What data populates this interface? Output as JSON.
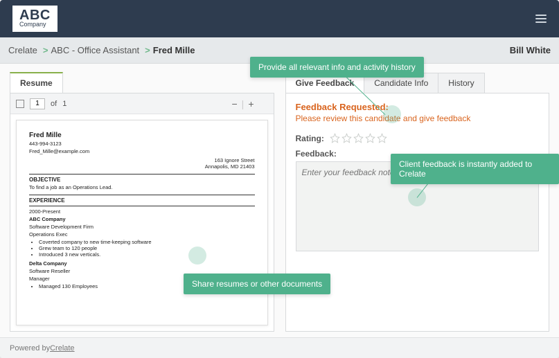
{
  "logo": {
    "big": "ABC",
    "small": "Company"
  },
  "breadcrumb": {
    "root": "Crelate",
    "level1": "ABC - Office Assistant",
    "current": "Fred Mille",
    "sep": ">"
  },
  "user_name": "Bill White",
  "left_panel": {
    "tabs": {
      "resume": "Resume"
    },
    "pdf": {
      "page_current": "1",
      "page_sep": "of",
      "page_total": "1",
      "zoom_out": "−",
      "zoom_in": "+"
    },
    "resume": {
      "name": "Fred Mille",
      "phone": "443-994-3123",
      "email": "Fred_Mille@example.com",
      "addr1": "163 Ignore Street",
      "addr2": "Annapolis, MD 21403",
      "sec1_title": "OBJECTIVE",
      "sec1_body": "To find a job as an Operations Lead.",
      "sec2_title": "EXPERIENCE",
      "exp1_dates": "2000-Present",
      "exp1_company": "ABC Company",
      "exp1_desc": "Software Development Firm",
      "exp1_role": "Operations Exec",
      "exp1_b1": "Coverted company to new time-keeping software",
      "exp1_b2": "Grew team to 120 people",
      "exp1_b3": "Introduced 3 new verticals.",
      "exp2_company": "Delta Company",
      "exp2_desc": "Software Reseller",
      "exp2_role": "Manager",
      "exp2_b1": "Managed 130 Employees"
    }
  },
  "right_panel": {
    "tabs": {
      "give": "Give Feedback",
      "info": "Candidate Info",
      "history": "History"
    },
    "fb_title": "Feedback Requested:",
    "fb_sub": "Please review this candidate and give feedback",
    "rating_label": "Rating:",
    "feedback_label": "Feedback:",
    "feedback_placeholder": "Enter your feedback notes here"
  },
  "footer": {
    "prefix": "Powered by ",
    "link": "Crelate"
  },
  "callouts": {
    "top": "Provide all relevant info and activity history",
    "left": "Share resumes or other documents",
    "right": "Client feedback is instantly added to Crelate"
  }
}
